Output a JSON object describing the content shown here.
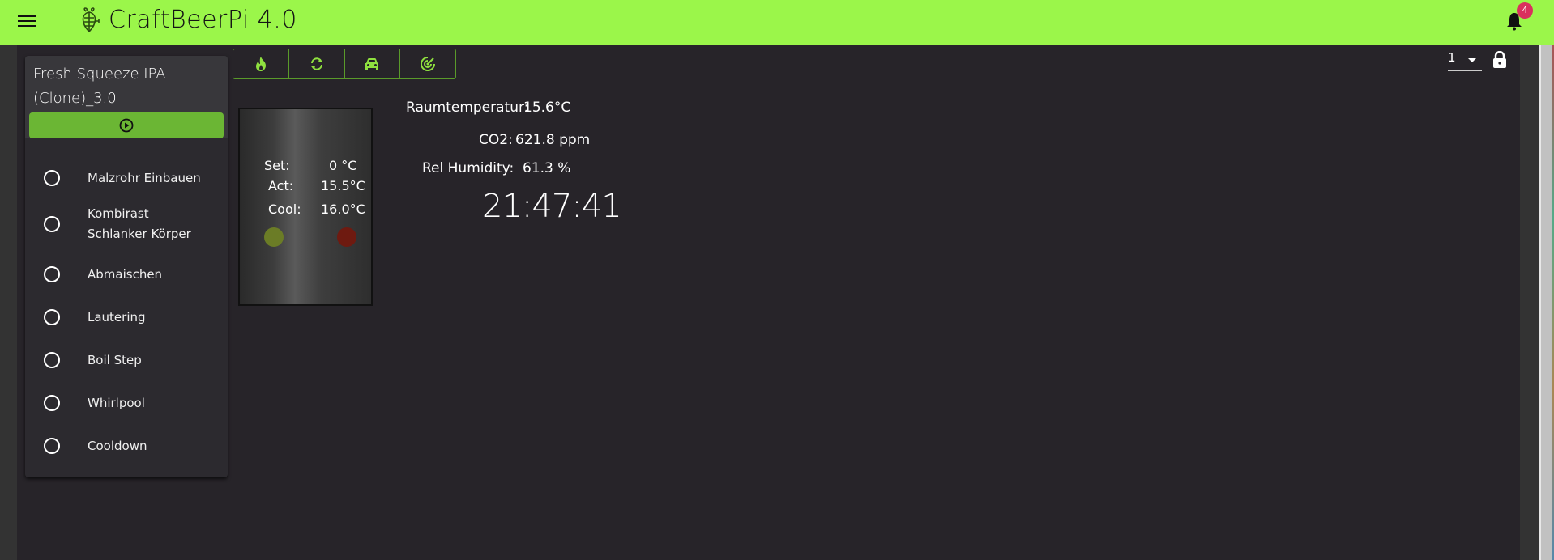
{
  "header": {
    "app_title": "CraftBeerPi 4.0",
    "notification_count": "4",
    "brand_color": "#9bf64a"
  },
  "recipe": {
    "name": "Fresh Squeeze IPA (Clone)_3.0",
    "start_icon": "play-circle-icon",
    "steps": [
      {
        "label": "Malzrohr Einbauen",
        "status": "inactive"
      },
      {
        "label": "Kombirast Schlanker Körper",
        "status": "inactive"
      },
      {
        "label": "Abmaischen",
        "status": "inactive"
      },
      {
        "label": "Lautering",
        "status": "inactive"
      },
      {
        "label": "Boil Step",
        "status": "inactive"
      },
      {
        "label": "Whirlpool",
        "status": "inactive"
      },
      {
        "label": "Cooldown",
        "status": "inactive"
      }
    ]
  },
  "toolbar": {
    "buttons": [
      {
        "icon": "flame-icon"
      },
      {
        "icon": "sync-icon"
      },
      {
        "icon": "car-icon"
      },
      {
        "icon": "target-icon"
      }
    ]
  },
  "kettle": {
    "set_label": "Set:",
    "set_value": "0 °C",
    "act_label": "Act:",
    "act_value": "15.5°C",
    "cool_label": "Cool:",
    "cool_value": "16.0°C",
    "heater_color": "#6b7c26",
    "cooler_color": "#6e1a10"
  },
  "sensors": [
    {
      "label": "Raumtemperatur:",
      "value": "15.6°C"
    },
    {
      "label": "CO2:",
      "value": "621.8 ppm"
    },
    {
      "label": "Rel Humidity:",
      "value": "61.3 %"
    }
  ],
  "clock": "21:47:41",
  "dashboard_select": {
    "value": "1"
  }
}
